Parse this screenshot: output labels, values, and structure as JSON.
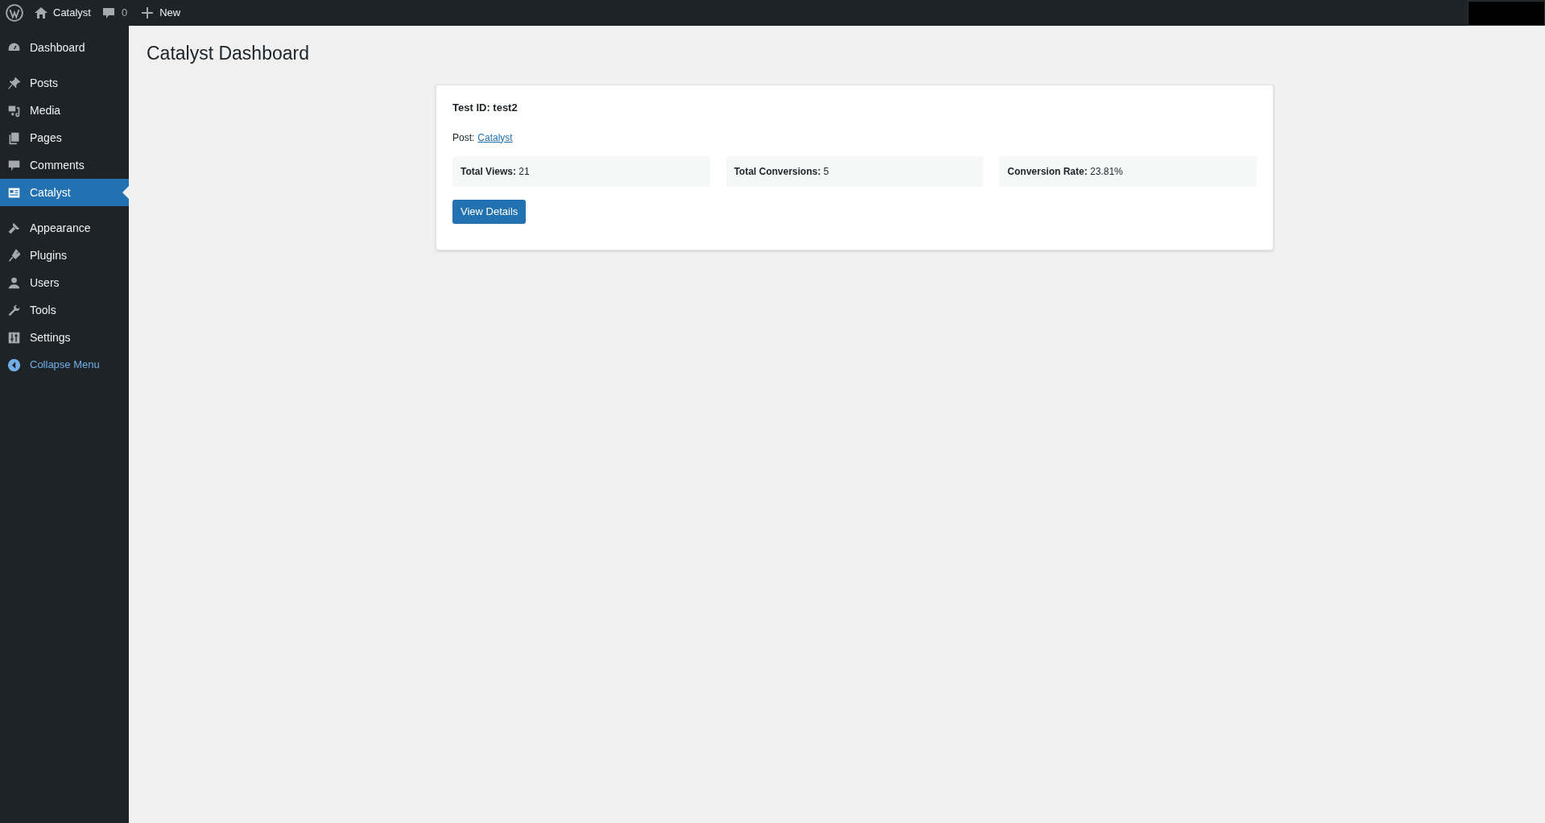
{
  "admin_bar": {
    "site_name": "Catalyst",
    "comments_count": "0",
    "new_label": "New"
  },
  "sidebar": {
    "groups": [
      [
        {
          "label": "Dashboard",
          "selected": false
        }
      ],
      [
        {
          "label": "Posts",
          "selected": false
        },
        {
          "label": "Media",
          "selected": false
        },
        {
          "label": "Pages",
          "selected": false
        },
        {
          "label": "Comments",
          "selected": false
        },
        {
          "label": "Catalyst",
          "selected": true
        }
      ],
      [
        {
          "label": "Appearance",
          "selected": false
        },
        {
          "label": "Plugins",
          "selected": false
        },
        {
          "label": "Users",
          "selected": false
        },
        {
          "label": "Tools",
          "selected": false
        },
        {
          "label": "Settings",
          "selected": false
        }
      ]
    ],
    "collapse_label": "Collapse Menu"
  },
  "page_title": "Catalyst Dashboard",
  "test_card": {
    "title": "Test ID: test2",
    "post_label": "Post:",
    "post_link": "Catalyst",
    "stats": [
      "**Total Views:** 21",
      "**Total Conversions:** 5",
      "**Conversion Rate:** 23.81%"
    ],
    "button": "View Details"
  }
}
